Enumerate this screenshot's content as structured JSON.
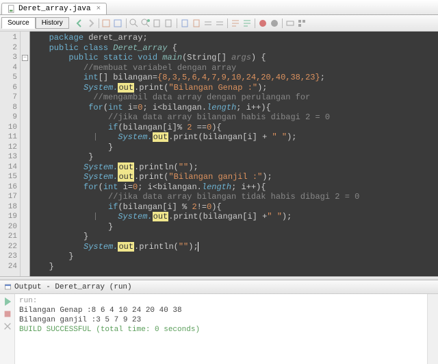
{
  "tab": {
    "filename": "Deret_array.java"
  },
  "miniTabs": {
    "source": "Source",
    "history": "History"
  },
  "code": {
    "lines": [
      1,
      2,
      3,
      4,
      5,
      6,
      7,
      8,
      9,
      10,
      11,
      12,
      13,
      14,
      15,
      16,
      17,
      18,
      19,
      20,
      21,
      22,
      23,
      24
    ],
    "l1": {
      "kw": "package",
      "pkg": " deret_array;"
    },
    "l2": {
      "kw1": "public",
      "kw2": "class",
      "cls": "Deret_array",
      "brace": " {"
    },
    "l3": {
      "kw1": "public",
      "kw2": "static",
      "kw3": "void",
      "mtd": "main",
      "sig1": "(String[] ",
      "arg": "args",
      "sig2": ") {"
    },
    "l4": {
      "cmt": "//membuat variabel dengan array"
    },
    "l5": {
      "type": "int",
      "arr": "[] bilangan=",
      "vals": "{8,3,5,6,4,7,9,10,24,20,40,38,23}",
      "end": ";"
    },
    "l6": {
      "sys": "System.",
      "out": "out",
      "call": ".print(",
      "str": "\"Bilangan Genap :\"",
      "end": ");"
    },
    "l7": {
      "cmt": "//mengambil data array dengan perulangan for"
    },
    "l8": {
      "kw": "for",
      "p1": "(",
      "type": "int",
      "v": " i=",
      "n0": "0",
      "sc": "; i",
      "lt": "<",
      "ar": "bilangan.",
      "len": "length",
      "p2": "; i++){"
    },
    "l9": {
      "cmt": "//jika data array bilangan habis dibagi 2 = 0"
    },
    "l10": {
      "kw": "if",
      "p1": "(bilangan[i]% ",
      "n2": "2",
      "eq": " ==",
      "n0": "0",
      "p2": "){"
    },
    "l11": {
      "sys": "System.",
      "out": "out",
      "call": ".print(bilangan[i] + ",
      "str": "\" \"",
      "end": ");"
    },
    "l12": {
      "brace": "}"
    },
    "l13": {
      "brace": "}"
    },
    "l14": {
      "sys": "System.",
      "out": "out",
      "call": ".println(",
      "str": "\"\"",
      "end": ");"
    },
    "l15": {
      "sys": "System.",
      "out": "out",
      "call": ".print(",
      "str": "\"Bilangan ganjil :\"",
      "end": ");"
    },
    "l16": {
      "kw": "for",
      "p1": "(",
      "type": "int",
      "v": " i=",
      "n0": "0",
      "sc": "; i",
      "lt": "<",
      "ar": "bilangan.",
      "len": "length",
      "p2": "; i++){"
    },
    "l17": {
      "cmt": "//jika data array bilangan tidak habis dibagi 2 = 0"
    },
    "l18": {
      "kw": "if",
      "p1": "(bilangan[i] % ",
      "n2": "2",
      "ne": "!=",
      "n0": "0",
      "p2": "){"
    },
    "l19": {
      "sys": "System.",
      "out": "out",
      "call": ".print(bilangan[i] +",
      "str": "\" \"",
      "end": ");"
    },
    "l20": {
      "brace": "}"
    },
    "l21": {
      "brace": "}"
    },
    "l22": {
      "sys": "System.",
      "out": "out",
      "call": ".println(",
      "str": "\"\"",
      "end": ");"
    },
    "l23": {
      "brace": "}"
    },
    "l24": {
      "brace": "}"
    }
  },
  "output": {
    "title": "Output - Deret_array (run)",
    "run": "run:",
    "line1": "Bilangan Genap :8 6 4 10 24 20 40 38 ",
    "line2": "Bilangan ganjil :3 5 7 9 23 ",
    "success": "BUILD SUCCESSFUL (total time: 0 seconds)"
  }
}
